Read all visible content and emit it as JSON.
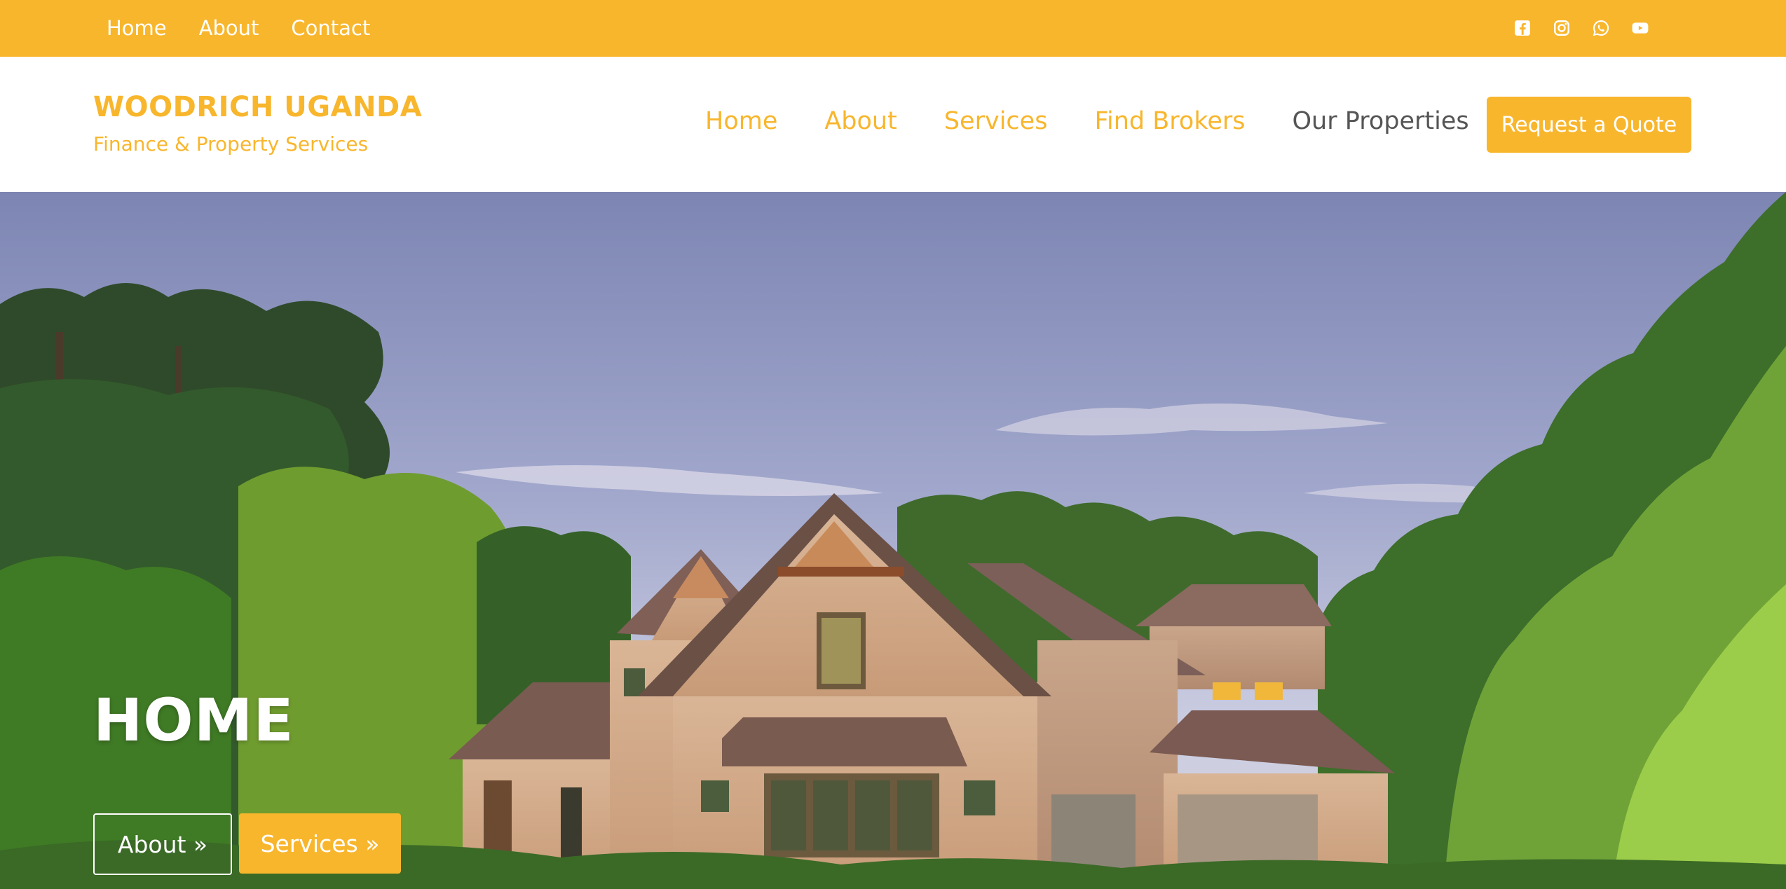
{
  "colors": {
    "brand": "#f8b62d",
    "active_nav": "#555555",
    "white": "#ffffff"
  },
  "topbar": {
    "links": [
      {
        "label": "Home"
      },
      {
        "label": "About"
      },
      {
        "label": "Contact"
      }
    ],
    "social": [
      {
        "icon": "facebook-icon"
      },
      {
        "icon": "instagram-icon"
      },
      {
        "icon": "whatsapp-icon"
      },
      {
        "icon": "youtube-icon"
      }
    ]
  },
  "header": {
    "brand_title": "WOODRICH UGANDA",
    "brand_subtitle": "Finance & Property Services",
    "nav": [
      {
        "label": "Home"
      },
      {
        "label": "About"
      },
      {
        "label": "Services"
      },
      {
        "label": "Find Brokers"
      },
      {
        "label": "Our Properties"
      }
    ],
    "active_nav": "Our Properties",
    "cta_label": "Request a Quote"
  },
  "hero": {
    "title": "HOME",
    "buttons": [
      {
        "label": "About »"
      },
      {
        "label": "Services »"
      }
    ]
  }
}
